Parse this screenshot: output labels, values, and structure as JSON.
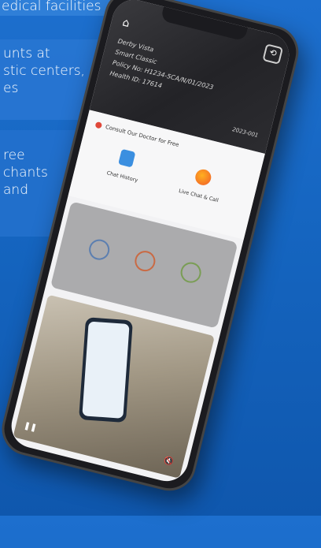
{
  "background_text": {
    "line1": "edical facilities",
    "line2": "unts at",
    "line3": "stic centers,",
    "line4": "es",
    "line5": "ree",
    "line6": "chants",
    "line7": "and"
  },
  "card": {
    "name": "Derby Vista",
    "plan": "Smart Classic",
    "policy": "Policy No: H1234-5CA/N/01/2023",
    "health_id": "Health ID: 17614",
    "card_number": "2023-001"
  },
  "consult": {
    "header": "Consult Our Doctor for Free",
    "option_chat_history": "Chat History",
    "option_live_chat": "Live Chat & Call"
  },
  "colors": {
    "brand_blue": "#1565c0"
  }
}
